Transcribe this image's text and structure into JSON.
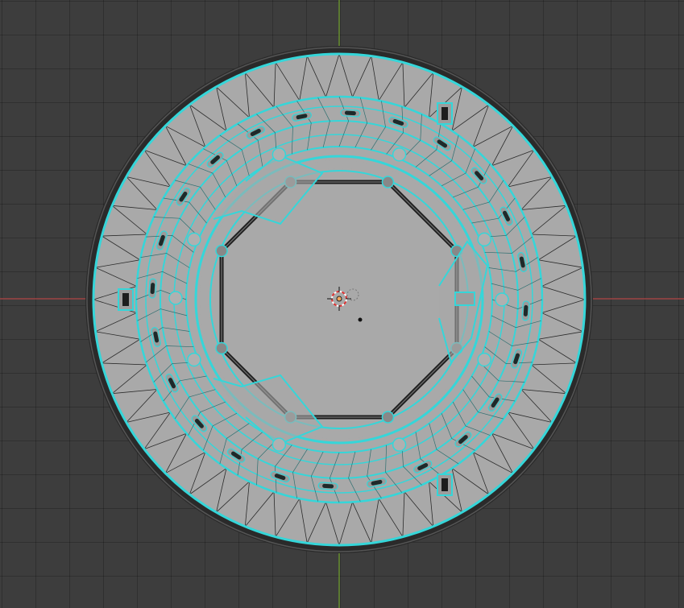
{
  "viewport": {
    "mode": "edit",
    "view": "top-orthographic",
    "background_color": "#3d3d3d",
    "grid_color": "#353535",
    "x_axis_color": "#c25050",
    "y_axis_color": "#76a030",
    "selection_color": "#35d6d9",
    "mesh_face_color": "#a9a9a9",
    "wire_color": "#1a1a1a",
    "icons": [
      "3d-cursor-icon",
      "object-origin-icon"
    ]
  }
}
